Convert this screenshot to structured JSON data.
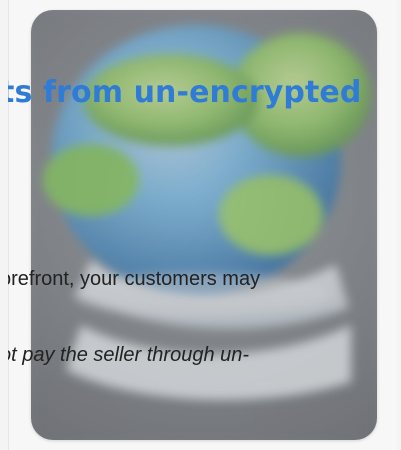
{
  "article": {
    "heading": "ts from un-encrypted",
    "line1": "orefront, your customers may",
    "line2": "ot pay the seller through un-"
  },
  "illustration": {
    "icon": "globe-icon",
    "accent": "#2f7bd6",
    "overlay": "#7f8286"
  }
}
